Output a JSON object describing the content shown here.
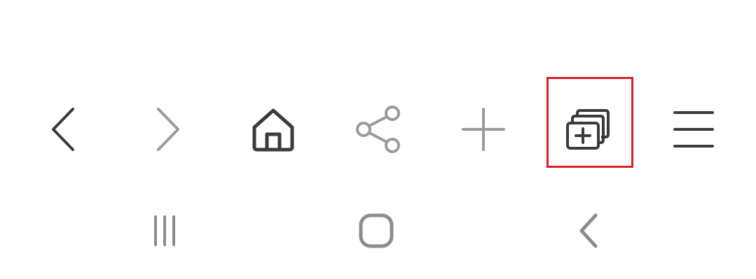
{
  "browser_toolbar": {
    "buttons": [
      {
        "icon": "back-icon",
        "enabled": true,
        "color": "#3a3a3a"
      },
      {
        "icon": "forward-icon",
        "enabled": false,
        "color": "#9a9a9a"
      },
      {
        "icon": "home-icon",
        "enabled": true,
        "color": "#3a3a3a"
      },
      {
        "icon": "share-icon",
        "enabled": false,
        "color": "#9a9a9a"
      },
      {
        "icon": "plus-icon",
        "enabled": false,
        "color": "#9a9a9a"
      },
      {
        "icon": "tabs-add-icon",
        "enabled": true,
        "color": "#3a3a3a",
        "highlighted": true
      },
      {
        "icon": "menu-icon",
        "enabled": true,
        "color": "#3a3a3a"
      }
    ],
    "highlight_color": "#d7202a"
  },
  "system_nav": {
    "buttons": [
      {
        "icon": "recent-apps-icon",
        "color": "#8c8c8c"
      },
      {
        "icon": "home-circle-icon",
        "color": "#8c8c8c"
      },
      {
        "icon": "nav-back-icon",
        "color": "#8c8c8c"
      }
    ]
  }
}
